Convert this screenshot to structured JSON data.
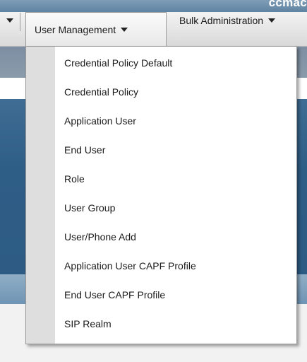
{
  "header": {
    "text": "ccmac"
  },
  "menubar": {
    "items": [
      {
        "label": "User Management"
      },
      {
        "label": "Bulk Administration"
      }
    ]
  },
  "dropdown": {
    "items": [
      "Credential Policy Default",
      "Credential Policy",
      "Application User",
      "End User",
      "Role",
      "User Group",
      "User/Phone Add",
      "Application User CAPF Profile",
      "End User CAPF Profile",
      "SIP Realm"
    ]
  }
}
